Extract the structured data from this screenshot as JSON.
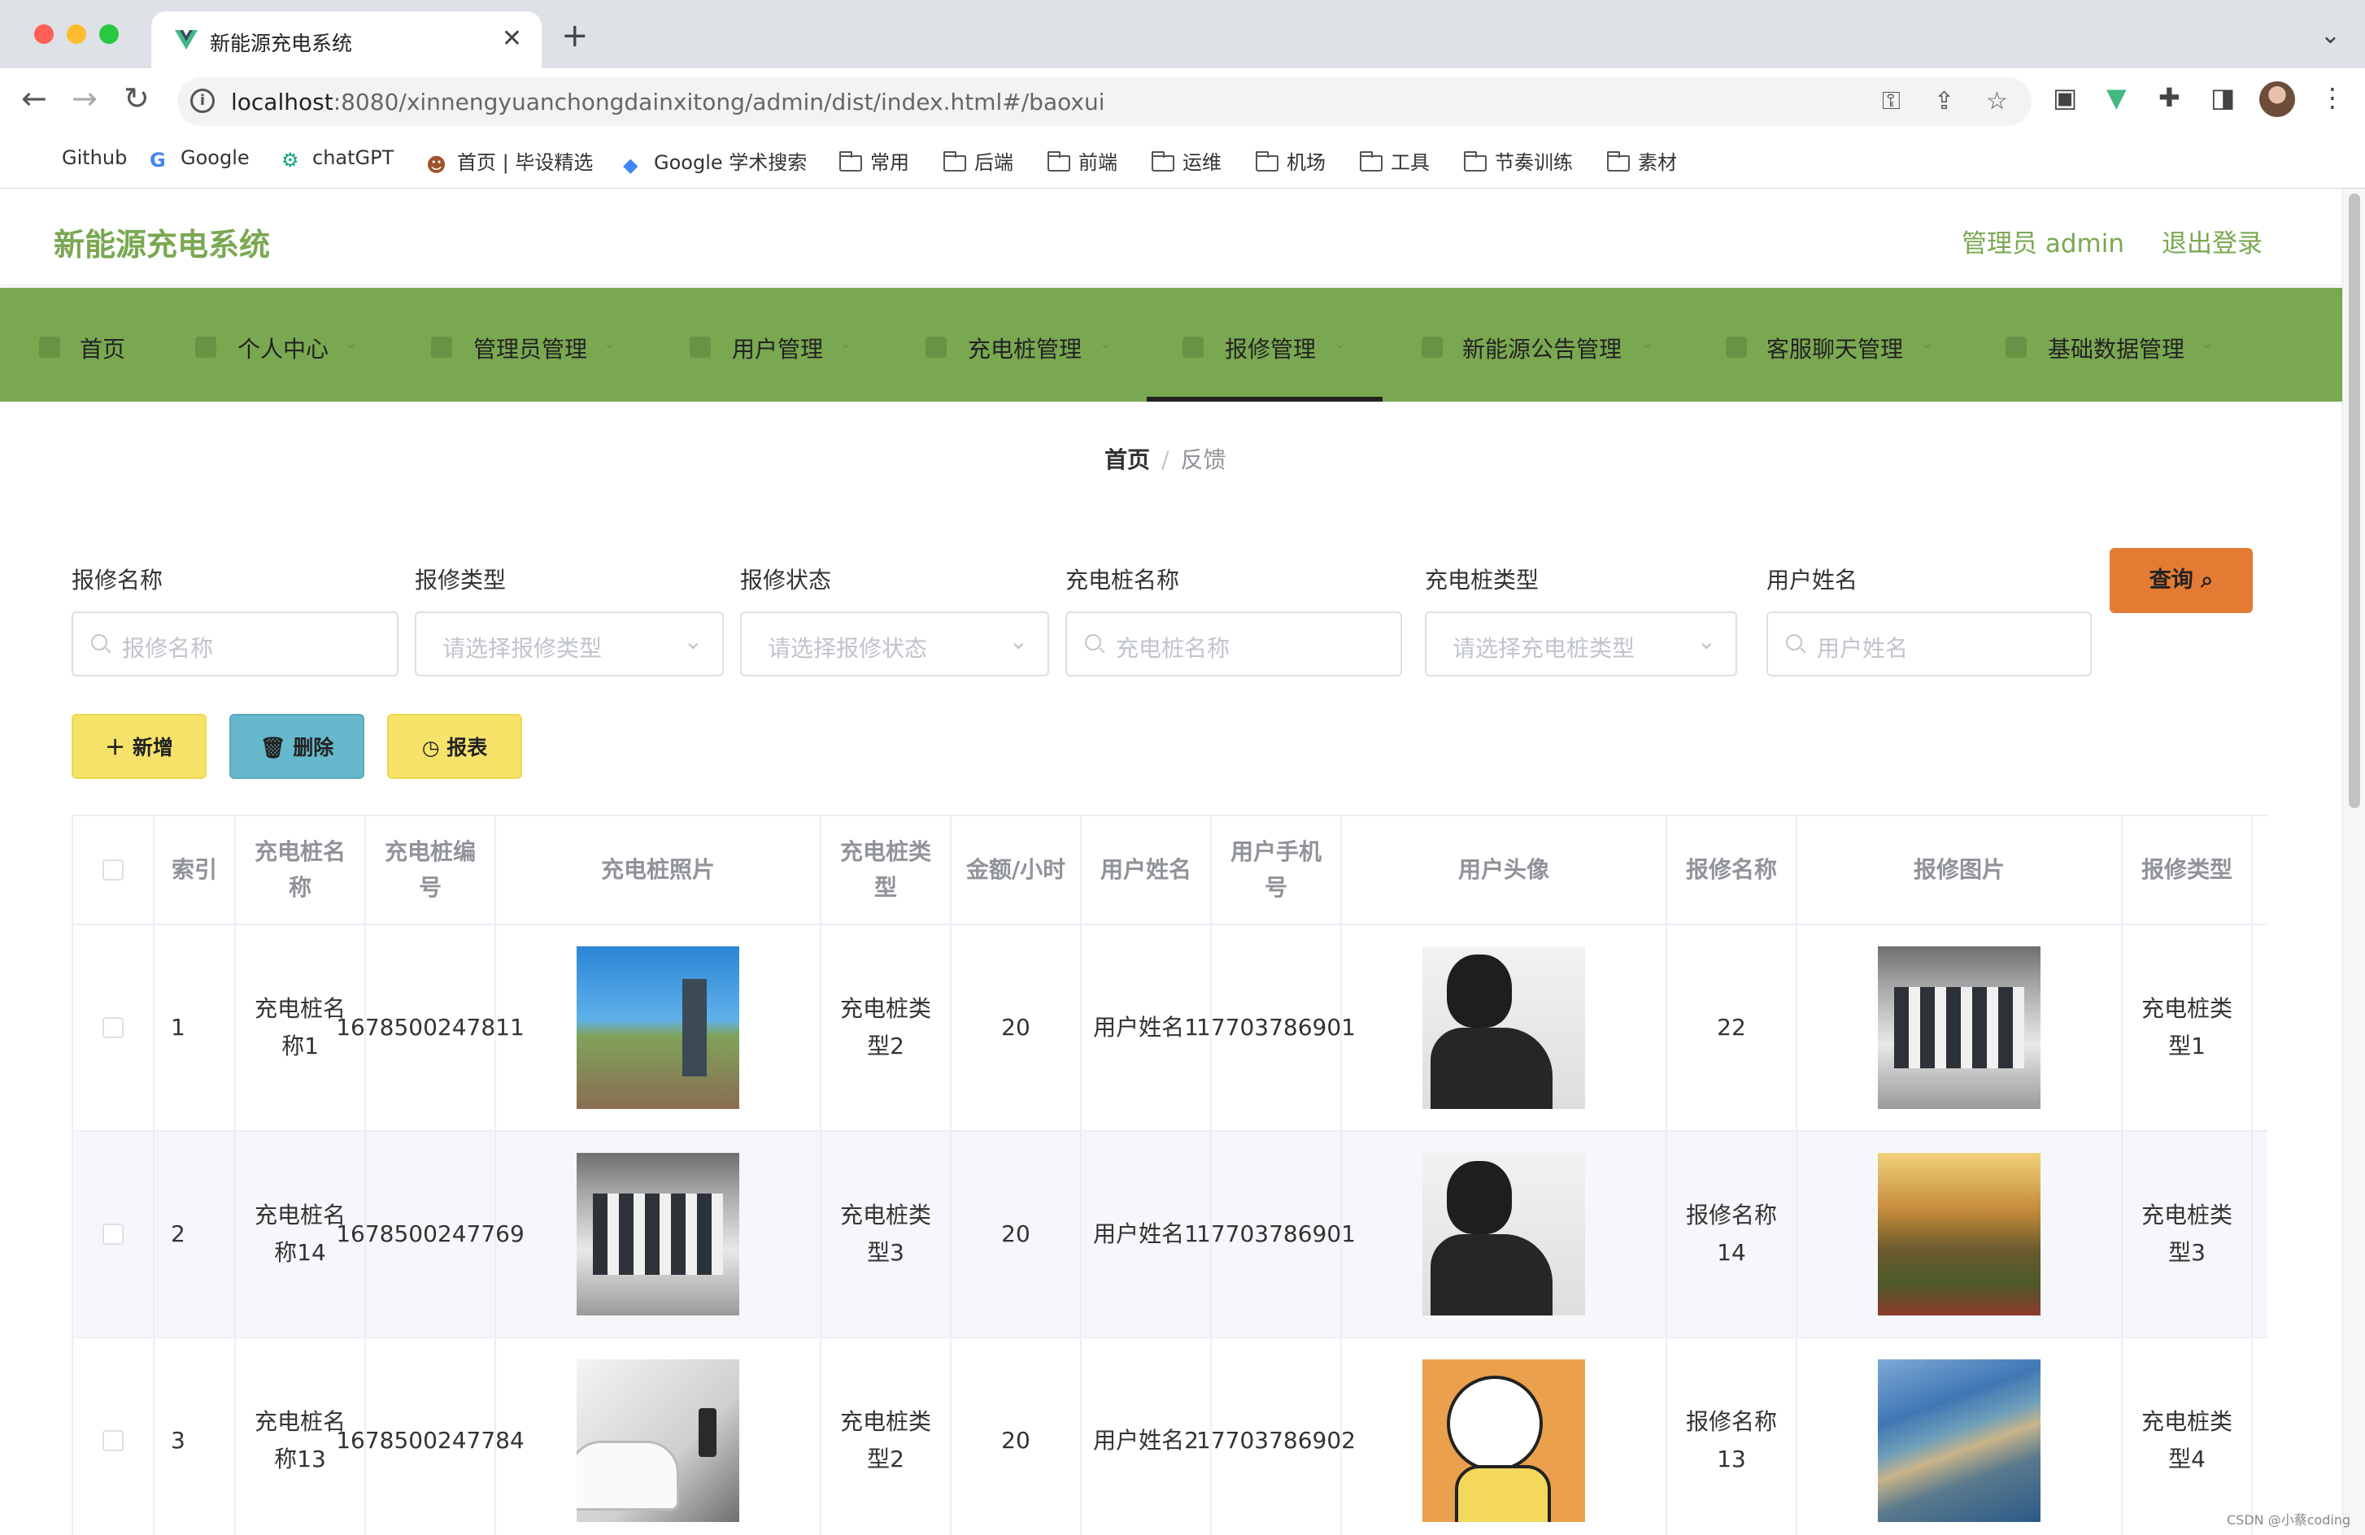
{
  "browser": {
    "tab_title": "新能源充电系统",
    "new_tab": "+",
    "close": "✕",
    "url_host": "localhost",
    "url_rest": ":8080/xinnengyuanchongdainxitong/admin/dist/index.html#/baoxui",
    "bookmarks": [
      "Github",
      "Google",
      "chatGPT",
      "首页 | 毕设精选",
      "Google 学术搜索",
      "常用",
      "后端",
      "前端",
      "运维",
      "机场",
      "工具",
      "节奏训练",
      "素材"
    ]
  },
  "header": {
    "title": "新能源充电系统",
    "admin_label": "管理员 admin",
    "logout": "退出登录"
  },
  "menu": [
    {
      "label": "首页",
      "icon": "home-icon"
    },
    {
      "label": "个人中心",
      "icon": "user-icon"
    },
    {
      "label": "管理员管理",
      "icon": "admin-icon"
    },
    {
      "label": "用户管理",
      "icon": "users-icon"
    },
    {
      "label": "充电桩管理",
      "icon": "charger-icon"
    },
    {
      "label": "报修管理",
      "icon": "list-icon",
      "active": true
    },
    {
      "label": "新能源公告管理",
      "icon": "notice-icon"
    },
    {
      "label": "客服聊天管理",
      "icon": "chat-icon"
    },
    {
      "label": "基础数据管理",
      "icon": "data-icon"
    }
  ],
  "breadcrumb": {
    "home": "首页",
    "separator": "/",
    "current": "反馈"
  },
  "search": {
    "fields": [
      {
        "label": "报修名称",
        "placeholder": "报修名称",
        "type": "input"
      },
      {
        "label": "报修类型",
        "placeholder": "请选择报修类型",
        "type": "select"
      },
      {
        "label": "报修状态",
        "placeholder": "请选择报修状态",
        "type": "select"
      },
      {
        "label": "充电桩名称",
        "placeholder": "充电桩名称",
        "type": "input"
      },
      {
        "label": "充电桩类型",
        "placeholder": "请选择充电桩类型",
        "type": "select"
      },
      {
        "label": "用户姓名",
        "placeholder": "用户姓名",
        "type": "input"
      }
    ],
    "query_button": "查询"
  },
  "actions": {
    "add": "新增",
    "delete": "删除",
    "report": "报表"
  },
  "colors": {
    "primary": "#7aa851",
    "query": "#e47b32",
    "yellow": "#f7e36a",
    "teal": "#66b8cc"
  },
  "table": {
    "columns": [
      "索引",
      "充电桩名称",
      "充电桩编号",
      "充电桩照片",
      "充电桩类型",
      "金额/小时",
      "用户姓名",
      "用户手机号",
      "用户头像",
      "报修名称",
      "报修图片",
      "报修类型"
    ],
    "rows": [
      {
        "index": "1",
        "station_name": "充电桩名称1",
        "station_no": "1678500247811",
        "station_type": "充电桩类型2",
        "price": "20",
        "user_name": "用户姓名1",
        "phone": "17703786901",
        "repair_name": "22",
        "repair_type": "充电桩类型1"
      },
      {
        "index": "2",
        "station_name": "充电桩名称14",
        "station_no": "1678500247769",
        "station_type": "充电桩类型3",
        "price": "20",
        "user_name": "用户姓名1",
        "phone": "17703786901",
        "repair_name": "报修名称14",
        "repair_type": "充电桩类型3"
      },
      {
        "index": "3",
        "station_name": "充电桩名称13",
        "station_no": "1678500247784",
        "station_type": "充电桩类型2",
        "price": "20",
        "user_name": "用户姓名2",
        "phone": "17703786902",
        "repair_name": "报修名称13",
        "repair_type": "充电桩类型4"
      }
    ]
  },
  "watermark": "CSDN @小蔡coding"
}
